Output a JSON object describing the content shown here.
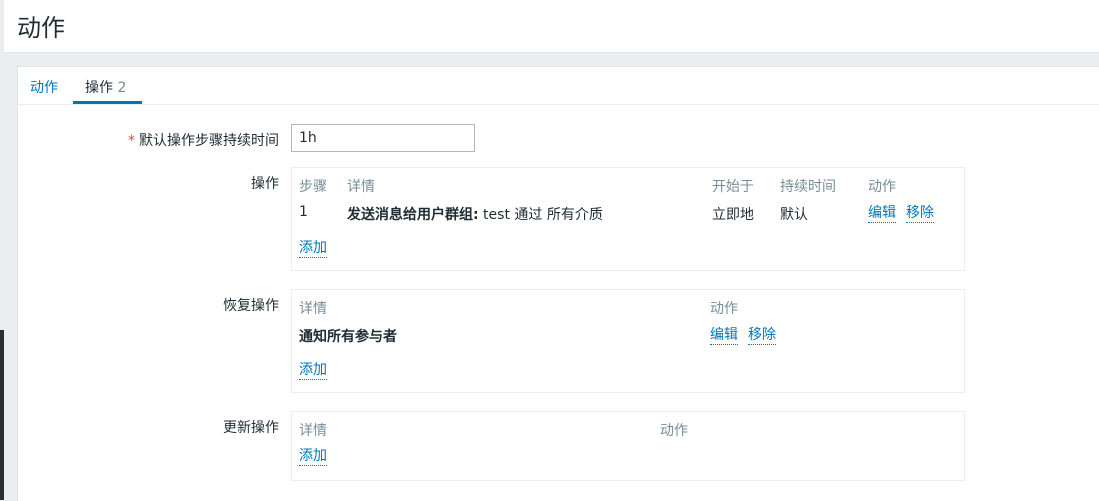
{
  "page": {
    "title": "动作"
  },
  "tabs": [
    {
      "label": "动作"
    },
    {
      "label": "操作",
      "count": "2"
    }
  ],
  "form": {
    "default_step_duration": {
      "label": "默认操作步骤持续时间",
      "required_mark": "*",
      "value": "1h"
    },
    "operations": {
      "label": "操作",
      "headers": {
        "step": "步骤",
        "details": "详情",
        "start_in": "开始于",
        "duration": "持续时间",
        "action": "动作"
      },
      "rows": [
        {
          "step": "1",
          "details_bold": "发送消息给用户群组:",
          "details_rest": " test 通过 所有介质",
          "start_in": "立即地",
          "duration": "默认",
          "edit": "编辑",
          "remove": "移除"
        }
      ],
      "add": "添加"
    },
    "recovery_operations": {
      "label": "恢复操作",
      "headers": {
        "details": "详情",
        "action": "动作"
      },
      "rows": [
        {
          "details": "通知所有参与者",
          "edit": "编辑",
          "remove": "移除"
        }
      ],
      "add": "添加"
    },
    "update_operations": {
      "label": "更新操作",
      "headers": {
        "details": "详情",
        "action": "动作"
      },
      "add": "添加"
    }
  }
}
